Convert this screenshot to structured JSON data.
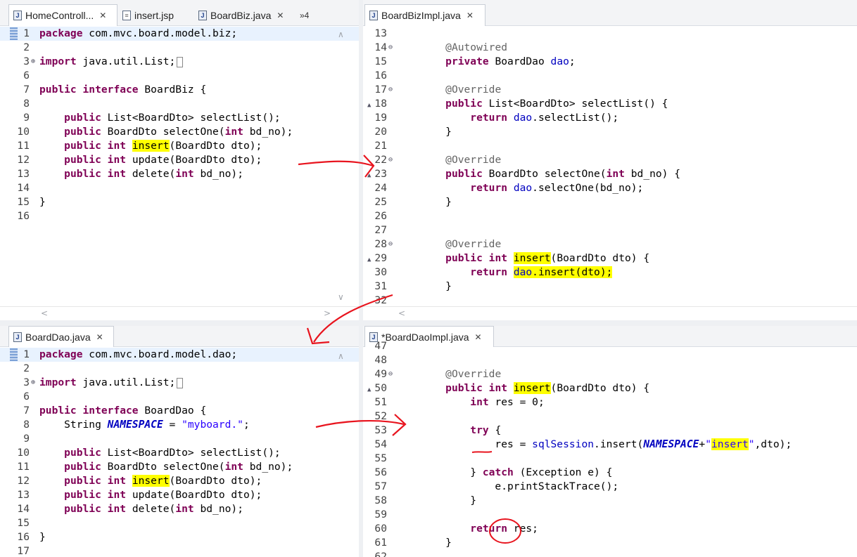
{
  "panes": {
    "top_left": {
      "tabs": [
        {
          "label": "HomeControll...",
          "icon": "java-file-icon",
          "closable": true,
          "active": true
        },
        {
          "label": "insert.jsp",
          "icon": "jsp-file-icon",
          "closable": false,
          "active": false
        },
        {
          "label": "BoardBiz.java",
          "icon": "java-file-icon",
          "closable": true,
          "active": false
        }
      ],
      "overflow_label": "»4",
      "lines": [
        {
          "num": "1",
          "current": true,
          "tokens": [
            [
              "kw",
              "package"
            ],
            [
              "t",
              " com.mvc.board.model.biz;"
            ]
          ]
        },
        {
          "num": "2",
          "tokens": []
        },
        {
          "num": "3",
          "fold": "plus",
          "tokens": [
            [
              "kw",
              "import"
            ],
            [
              "t",
              " java.util.List;"
            ],
            [
              "box",
              "□"
            ]
          ]
        },
        {
          "num": "6",
          "tokens": []
        },
        {
          "num": "7",
          "tokens": [
            [
              "kw",
              "public"
            ],
            [
              "t",
              " "
            ],
            [
              "kw",
              "interface"
            ],
            [
              "t",
              " BoardBiz {"
            ]
          ]
        },
        {
          "num": "8",
          "tokens": []
        },
        {
          "num": "9",
          "tokens": [
            [
              "t",
              "    "
            ],
            [
              "kw",
              "public"
            ],
            [
              "t",
              " List<BoardDto> selectList();"
            ]
          ]
        },
        {
          "num": "10",
          "tokens": [
            [
              "t",
              "    "
            ],
            [
              "kw",
              "public"
            ],
            [
              "t",
              " BoardDto selectOne("
            ],
            [
              "kw",
              "int"
            ],
            [
              "t",
              " bd_no);"
            ]
          ]
        },
        {
          "num": "11",
          "tokens": [
            [
              "t",
              "    "
            ],
            [
              "kw",
              "public"
            ],
            [
              "t",
              " "
            ],
            [
              "kw",
              "int"
            ],
            [
              "t",
              " "
            ],
            [
              "hl",
              "insert"
            ],
            [
              "t",
              "(BoardDto dto);"
            ]
          ]
        },
        {
          "num": "12",
          "tokens": [
            [
              "t",
              "    "
            ],
            [
              "kw",
              "public"
            ],
            [
              "t",
              " "
            ],
            [
              "kw",
              "int"
            ],
            [
              "t",
              " update(BoardDto dto);"
            ]
          ]
        },
        {
          "num": "13",
          "tokens": [
            [
              "t",
              "    "
            ],
            [
              "kw",
              "public"
            ],
            [
              "t",
              " "
            ],
            [
              "kw",
              "int"
            ],
            [
              "t",
              " delete("
            ],
            [
              "kw",
              "int"
            ],
            [
              "t",
              " bd_no);"
            ]
          ]
        },
        {
          "num": "14",
          "tokens": []
        },
        {
          "num": "15",
          "tokens": [
            [
              "t",
              "}"
            ]
          ]
        },
        {
          "num": "16",
          "tokens": []
        }
      ]
    },
    "top_right": {
      "tabs": [
        {
          "label": "BoardBizImpl.java",
          "icon": "java-file-icon",
          "closable": true,
          "active": true
        }
      ],
      "lines": [
        {
          "num": "13",
          "tokens": []
        },
        {
          "num": "14",
          "fold": "minus",
          "tokens": [
            [
              "t",
              "    "
            ],
            [
              "an",
              "@Autowired"
            ]
          ]
        },
        {
          "num": "15",
          "tokens": [
            [
              "t",
              "    "
            ],
            [
              "kw",
              "private"
            ],
            [
              "t",
              " BoardDao "
            ],
            [
              "fld",
              "dao"
            ],
            [
              "t",
              ";"
            ]
          ]
        },
        {
          "num": "16",
          "tokens": []
        },
        {
          "num": "17",
          "fold": "minus",
          "tokens": [
            [
              "t",
              "    "
            ],
            [
              "an",
              "@Override"
            ]
          ]
        },
        {
          "num": "18",
          "marker": "override",
          "tokens": [
            [
              "t",
              "    "
            ],
            [
              "kw",
              "public"
            ],
            [
              "t",
              " List<BoardDto> selectList() {"
            ]
          ]
        },
        {
          "num": "19",
          "tokens": [
            [
              "t",
              "        "
            ],
            [
              "kw",
              "return"
            ],
            [
              "t",
              " "
            ],
            [
              "fld",
              "dao"
            ],
            [
              "t",
              ".selectList();"
            ]
          ]
        },
        {
          "num": "20",
          "tokens": [
            [
              "t",
              "    }"
            ]
          ]
        },
        {
          "num": "21",
          "tokens": []
        },
        {
          "num": "22",
          "fold": "minus",
          "tokens": [
            [
              "t",
              "    "
            ],
            [
              "an",
              "@Override"
            ]
          ]
        },
        {
          "num": "23",
          "marker": "override",
          "tokens": [
            [
              "t",
              "    "
            ],
            [
              "kw",
              "public"
            ],
            [
              "t",
              " BoardDto selectOne("
            ],
            [
              "kw",
              "int"
            ],
            [
              "t",
              " bd_no) {"
            ]
          ]
        },
        {
          "num": "24",
          "tokens": [
            [
              "t",
              "        "
            ],
            [
              "kw",
              "return"
            ],
            [
              "t",
              " "
            ],
            [
              "fld",
              "dao"
            ],
            [
              "t",
              ".selectOne(bd_no);"
            ]
          ]
        },
        {
          "num": "25",
          "tokens": [
            [
              "t",
              "    }"
            ]
          ]
        },
        {
          "num": "26",
          "tokens": []
        },
        {
          "num": "27",
          "tokens": []
        },
        {
          "num": "28",
          "fold": "minus",
          "tokens": [
            [
              "t",
              "    "
            ],
            [
              "an",
              "@Override"
            ]
          ]
        },
        {
          "num": "29",
          "marker": "override",
          "tokens": [
            [
              "t",
              "    "
            ],
            [
              "kw",
              "public"
            ],
            [
              "t",
              " "
            ],
            [
              "kw",
              "int"
            ],
            [
              "t",
              " "
            ],
            [
              "hl",
              "insert"
            ],
            [
              "t",
              "(BoardDto dto) {"
            ]
          ]
        },
        {
          "num": "30",
          "tokens": [
            [
              "t",
              "        "
            ],
            [
              "kw",
              "return"
            ],
            [
              "t",
              " "
            ],
            [
              "hlf",
              "dao"
            ],
            [
              "hl",
              ".insert(dto);"
            ]
          ]
        },
        {
          "num": "31",
          "tokens": [
            [
              "t",
              "    }"
            ]
          ]
        },
        {
          "num": "32",
          "tokens": []
        }
      ]
    },
    "bottom_left": {
      "tabs": [
        {
          "label": "BoardDao.java",
          "icon": "java-file-icon",
          "closable": true,
          "active": true
        }
      ],
      "lines": [
        {
          "num": "1",
          "current": true,
          "tokens": [
            [
              "kw",
              "package"
            ],
            [
              "t",
              " com.mvc.board.model.dao;"
            ]
          ]
        },
        {
          "num": "2",
          "tokens": []
        },
        {
          "num": "3",
          "fold": "plus",
          "tokens": [
            [
              "kw",
              "import"
            ],
            [
              "t",
              " java.util.List;"
            ],
            [
              "box",
              "□"
            ]
          ]
        },
        {
          "num": "6",
          "tokens": []
        },
        {
          "num": "7",
          "tokens": [
            [
              "kw",
              "public"
            ],
            [
              "t",
              " "
            ],
            [
              "kw",
              "interface"
            ],
            [
              "t",
              " BoardDao {"
            ]
          ]
        },
        {
          "num": "8",
          "tokens": [
            [
              "t",
              "    String "
            ],
            [
              "cst",
              "NAMESPACE"
            ],
            [
              "t",
              " = "
            ],
            [
              "str",
              "\"myboard.\""
            ],
            [
              "t",
              ";"
            ]
          ]
        },
        {
          "num": "9",
          "tokens": []
        },
        {
          "num": "10",
          "tokens": [
            [
              "t",
              "    "
            ],
            [
              "kw",
              "public"
            ],
            [
              "t",
              " List<BoardDto> selectList();"
            ]
          ]
        },
        {
          "num": "11",
          "tokens": [
            [
              "t",
              "    "
            ],
            [
              "kw",
              "public"
            ],
            [
              "t",
              " BoardDto selectOne("
            ],
            [
              "kw",
              "int"
            ],
            [
              "t",
              " bd_no);"
            ]
          ]
        },
        {
          "num": "12",
          "tokens": [
            [
              "t",
              "    "
            ],
            [
              "kw",
              "public"
            ],
            [
              "t",
              " "
            ],
            [
              "kw",
              "int"
            ],
            [
              "t",
              " "
            ],
            [
              "hl",
              "insert"
            ],
            [
              "t",
              "(BoardDto dto);"
            ]
          ]
        },
        {
          "num": "13",
          "tokens": [
            [
              "t",
              "    "
            ],
            [
              "kw",
              "public"
            ],
            [
              "t",
              " "
            ],
            [
              "kw",
              "int"
            ],
            [
              "t",
              " update(BoardDto dto);"
            ]
          ]
        },
        {
          "num": "14",
          "tokens": [
            [
              "t",
              "    "
            ],
            [
              "kw",
              "public"
            ],
            [
              "t",
              " "
            ],
            [
              "kw",
              "int"
            ],
            [
              "t",
              " delete("
            ],
            [
              "kw",
              "int"
            ],
            [
              "t",
              " bd_no);"
            ]
          ]
        },
        {
          "num": "15",
          "tokens": []
        },
        {
          "num": "16",
          "tokens": [
            [
              "t",
              "}"
            ]
          ]
        },
        {
          "num": "17",
          "tokens": []
        }
      ]
    },
    "bottom_right": {
      "tabs": [
        {
          "label": "*BoardDaoImpl.java",
          "icon": "java-file-icon",
          "closable": true,
          "active": true
        }
      ],
      "lines": [
        {
          "num": "47",
          "tokens": []
        },
        {
          "num": "48",
          "tokens": []
        },
        {
          "num": "49",
          "fold": "minus",
          "tokens": [
            [
              "t",
              "    "
            ],
            [
              "an",
              "@Override"
            ]
          ]
        },
        {
          "num": "50",
          "marker": "override",
          "tokens": [
            [
              "t",
              "    "
            ],
            [
              "kw",
              "public"
            ],
            [
              "t",
              " "
            ],
            [
              "kw",
              "int"
            ],
            [
              "t",
              " "
            ],
            [
              "hl",
              "insert"
            ],
            [
              "t",
              "(BoardDto dto) {"
            ]
          ]
        },
        {
          "num": "51",
          "tokens": [
            [
              "t",
              "        "
            ],
            [
              "kw",
              "int"
            ],
            [
              "t",
              " res = 0;"
            ]
          ]
        },
        {
          "num": "52",
          "tokens": []
        },
        {
          "num": "53",
          "tokens": [
            [
              "t",
              "        "
            ],
            [
              "kw",
              "try"
            ],
            [
              "t",
              " {"
            ]
          ]
        },
        {
          "num": "54",
          "tokens": [
            [
              "t",
              "            res = "
            ],
            [
              "fld",
              "sqlSession"
            ],
            [
              "t",
              ".insert("
            ],
            [
              "cst",
              "NAMESPACE"
            ],
            [
              "t",
              "+"
            ],
            [
              "str",
              "\""
            ],
            [
              "hlstr",
              "insert"
            ],
            [
              "str",
              "\""
            ],
            [
              "t",
              ",dto);"
            ]
          ]
        },
        {
          "num": "55",
          "tokens": []
        },
        {
          "num": "56",
          "tokens": [
            [
              "t",
              "        } "
            ],
            [
              "kw",
              "catch"
            ],
            [
              "t",
              " (Exception e) {"
            ]
          ]
        },
        {
          "num": "57",
          "tokens": [
            [
              "t",
              "            e.printStackTrace();"
            ]
          ]
        },
        {
          "num": "58",
          "tokens": [
            [
              "t",
              "        }"
            ]
          ]
        },
        {
          "num": "59",
          "tokens": []
        },
        {
          "num": "60",
          "tokens": [
            [
              "t",
              "        "
            ],
            [
              "kw",
              "return"
            ],
            [
              "t",
              " res;"
            ]
          ]
        },
        {
          "num": "61",
          "tokens": [
            [
              "t",
              "    }"
            ]
          ]
        },
        {
          "num": "62",
          "tokens": []
        }
      ]
    }
  },
  "annotation_color": "#e8141e"
}
